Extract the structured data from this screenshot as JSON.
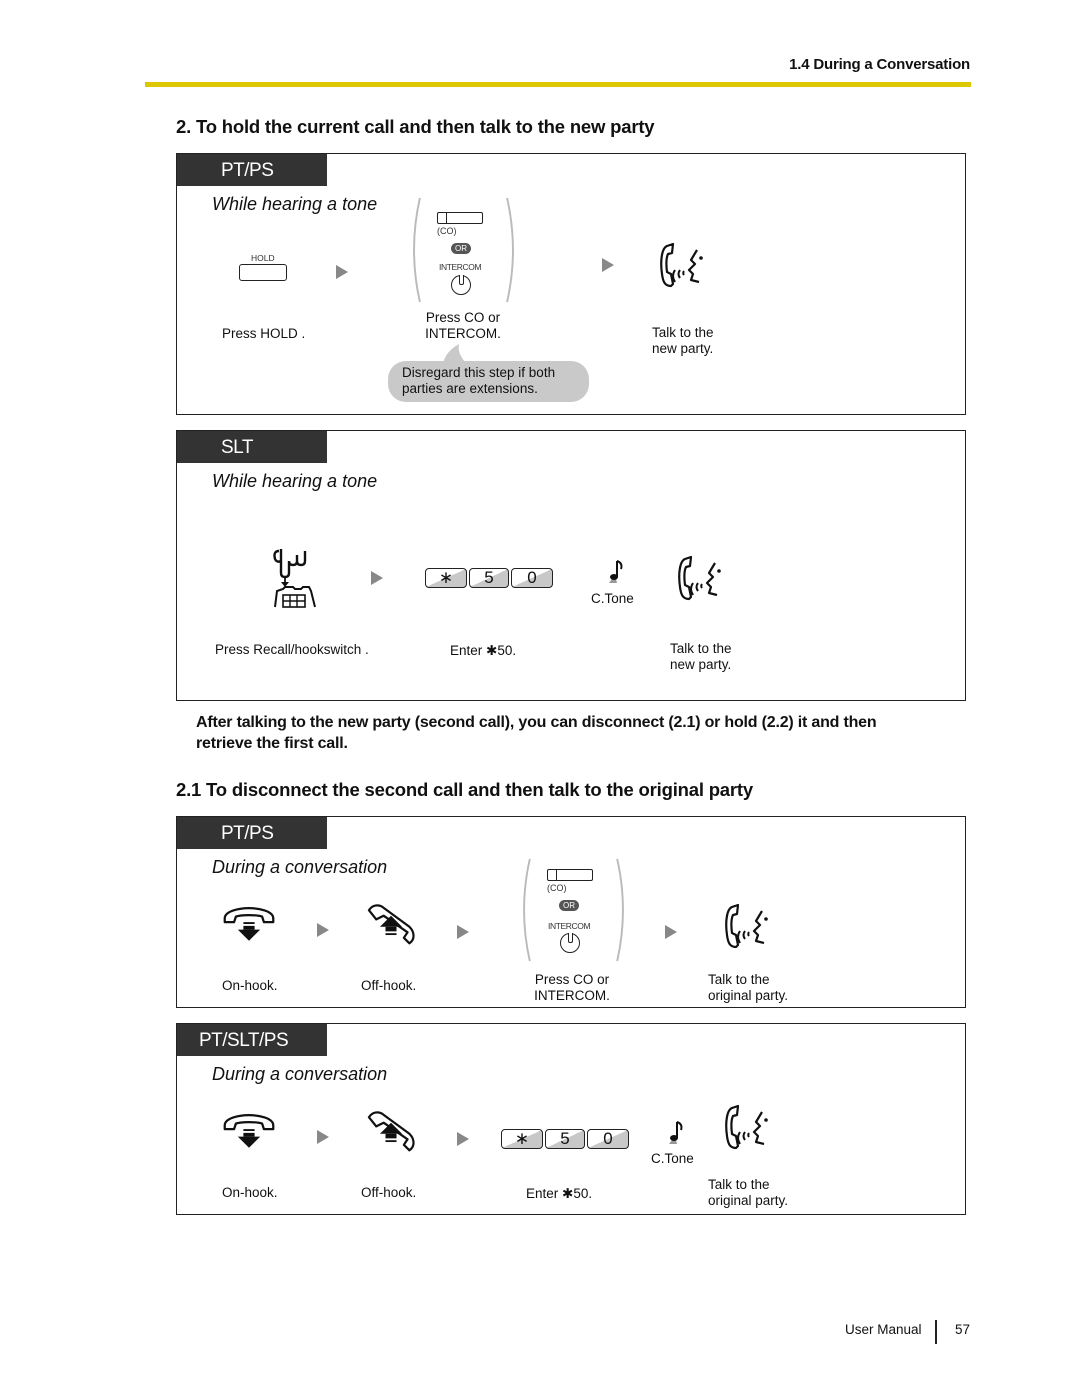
{
  "header": {
    "section": "1.4 During a Conversation",
    "rule_color": "#dcc700"
  },
  "section2": {
    "title": "2. To hold the current call and then talk to the new party",
    "pt_ps": {
      "tag": "PT/PS",
      "condition": "While hearing a tone",
      "hold_key_label": "HOLD",
      "co_label": "(CO)",
      "or_label": "OR",
      "intercom_label": "INTERCOM",
      "step1": "Press HOLD .",
      "step2_line1": "Press CO  or",
      "step2_line2": "INTERCOM.",
      "step3_line1": "Talk to the",
      "step3_line2": "new party.",
      "note_line1": "Disregard this step if both",
      "note_line2": "parties are extensions."
    },
    "slt": {
      "tag": "SLT",
      "condition": "While hearing a tone",
      "keys": [
        "∗",
        "5",
        "0"
      ],
      "ctone": "C.Tone",
      "step1": "Press Recall/hookswitch   .",
      "step2": "Enter ✱50.",
      "step3_line1": "Talk to the",
      "step3_line2": "new party."
    },
    "after_note_line1": "After talking to the new party (second call), you can disconnect (2.1) or hold (2.2) it and then",
    "after_note_line2": "retrieve the first call."
  },
  "section21": {
    "title": "2.1 To disconnect the second call and then talk to the original party",
    "pt_ps": {
      "tag": "PT/PS",
      "condition": "During a conversation",
      "co_label": "(CO)",
      "or_label": "OR",
      "intercom_label": "INTERCOM",
      "step1": "On-hook.",
      "step2": "Off-hook.",
      "step3_line1": "Press CO  or",
      "step3_line2": "INTERCOM.",
      "step4_line1": "Talk to the",
      "step4_line2": "original party."
    },
    "pt_slt_ps": {
      "tag": "PT/SLT/PS",
      "condition": "During a conversation",
      "keys": [
        "∗",
        "5",
        "0"
      ],
      "ctone": "C.Tone",
      "step1": "On-hook.",
      "step2": "Off-hook.",
      "step3": "Enter ✱50.",
      "step4_line1": "Talk to the",
      "step4_line2": "original party."
    }
  },
  "footer": {
    "label": "User Manual",
    "page": "57"
  },
  "icons": {
    "talk": "handset-talking-icon",
    "onhook": "on-hook-handset-icon",
    "offhook": "off-hook-handset-icon",
    "recall": "recall-hookswitch-icon",
    "ctone": "confirmation-tone-icon",
    "arrow": "next-step-arrow-icon"
  }
}
